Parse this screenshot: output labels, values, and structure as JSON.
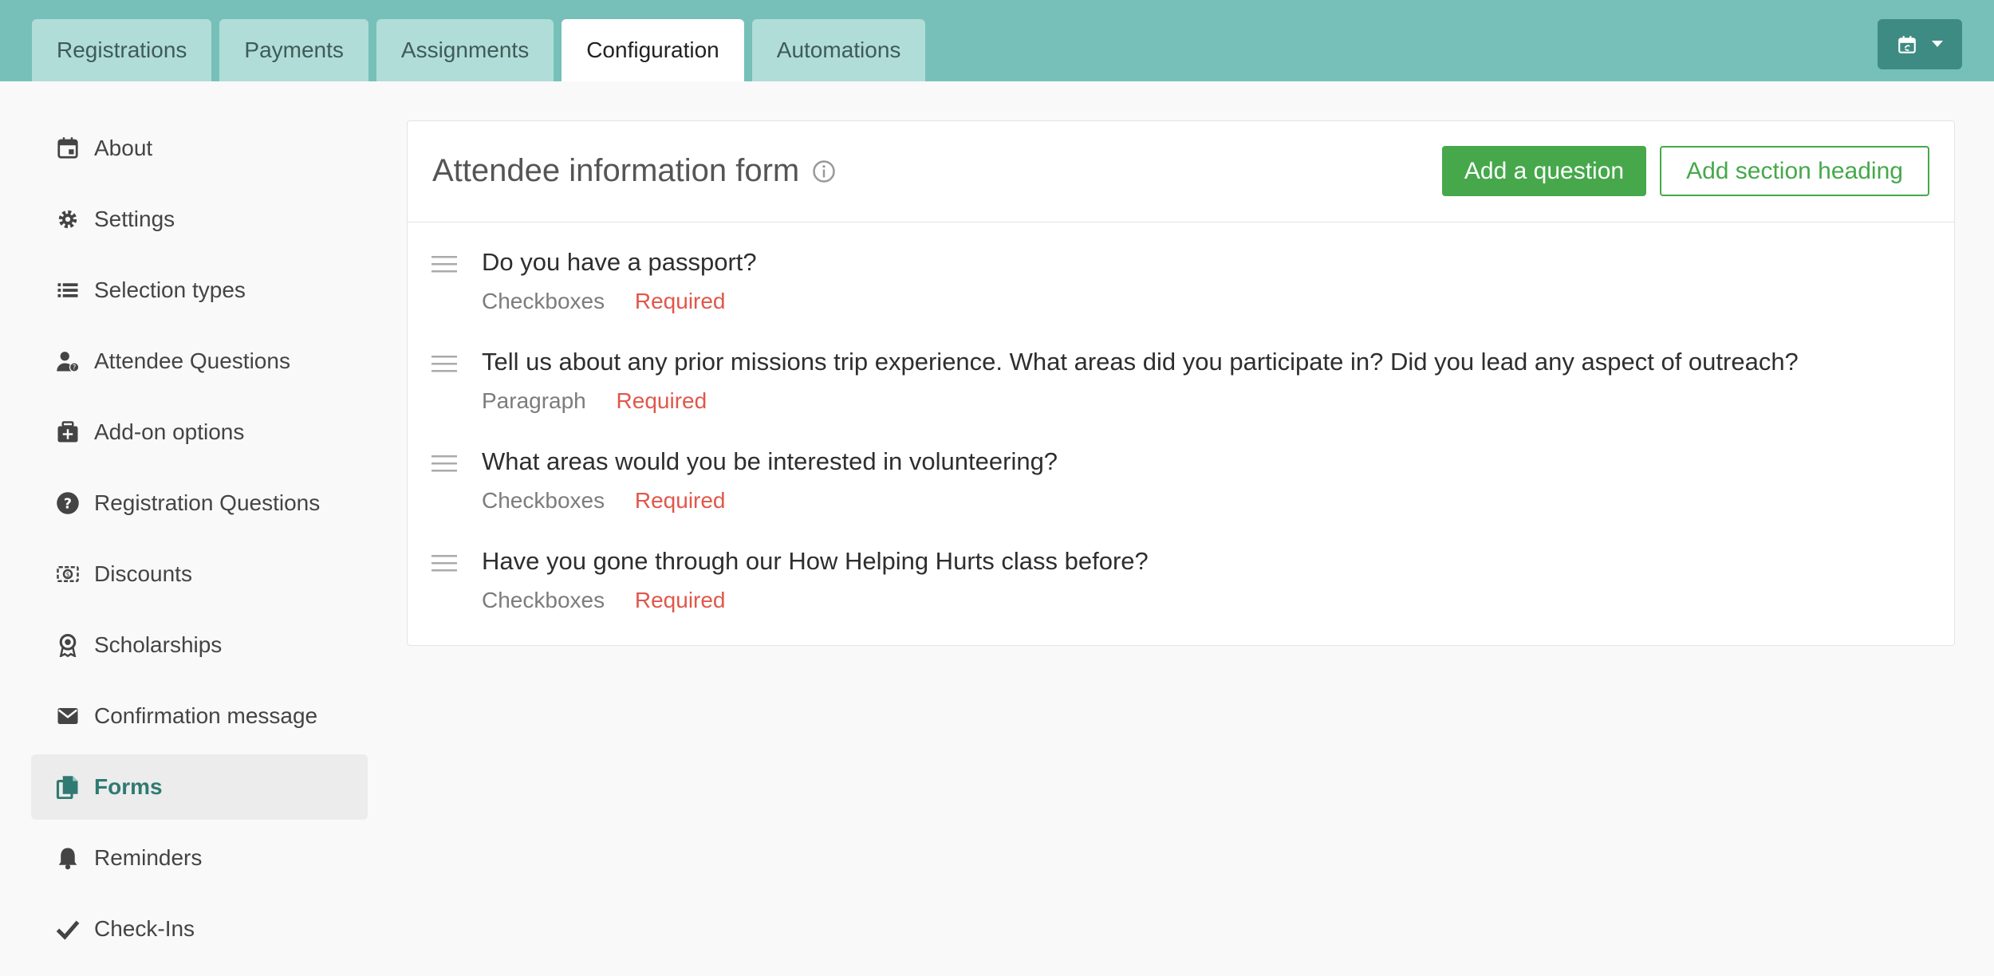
{
  "tabs": [
    {
      "label": "Registrations",
      "active": false
    },
    {
      "label": "Payments",
      "active": false
    },
    {
      "label": "Assignments",
      "active": false
    },
    {
      "label": "Configuration",
      "active": true
    },
    {
      "label": "Automations",
      "active": false
    }
  ],
  "calendar_button": {
    "icon": "calendar-sync-icon",
    "caret": "caret-down-icon"
  },
  "sidebar": {
    "items": [
      {
        "label": "About",
        "icon": "calendar-icon",
        "active": false
      },
      {
        "label": "Settings",
        "icon": "gear-icon",
        "active": false
      },
      {
        "label": "Selection types",
        "icon": "list-icon",
        "active": false
      },
      {
        "label": "Attendee Questions",
        "icon": "person-question-icon",
        "active": false
      },
      {
        "label": "Add-on options",
        "icon": "add-box-icon",
        "active": false
      },
      {
        "label": "Registration Questions",
        "icon": "question-circle-icon",
        "active": false
      },
      {
        "label": "Discounts",
        "icon": "discount-icon",
        "active": false
      },
      {
        "label": "Scholarships",
        "icon": "award-icon",
        "active": false
      },
      {
        "label": "Confirmation message",
        "icon": "envelope-icon",
        "active": false
      },
      {
        "label": "Forms",
        "icon": "forms-icon",
        "active": true
      },
      {
        "label": "Reminders",
        "icon": "bell-icon",
        "active": false
      },
      {
        "label": "Check-Ins",
        "icon": "check-icon",
        "active": false
      }
    ]
  },
  "panel": {
    "title": "Attendee information form",
    "add_question_label": "Add a question",
    "add_section_label": "Add section heading",
    "questions": [
      {
        "text": "Do you have a passport?",
        "type": "Checkboxes",
        "required": "Required"
      },
      {
        "text": "Tell us about any prior missions trip experience. What areas did you participate in? Did you lead any aspect of outreach?",
        "type": "Paragraph",
        "required": "Required"
      },
      {
        "text": "What areas would you be interested in volunteering?",
        "type": "Checkboxes",
        "required": "Required"
      },
      {
        "text": "Have you gone through our How Helping Hurts class before?",
        "type": "Checkboxes",
        "required": "Required"
      }
    ]
  },
  "colors": {
    "topbar": "#76c0b9",
    "tab_inactive": "#b0ddd7",
    "accent_green": "#46a84b",
    "required_red": "#e0574a",
    "active_sidebar_text": "#2f7a72"
  }
}
